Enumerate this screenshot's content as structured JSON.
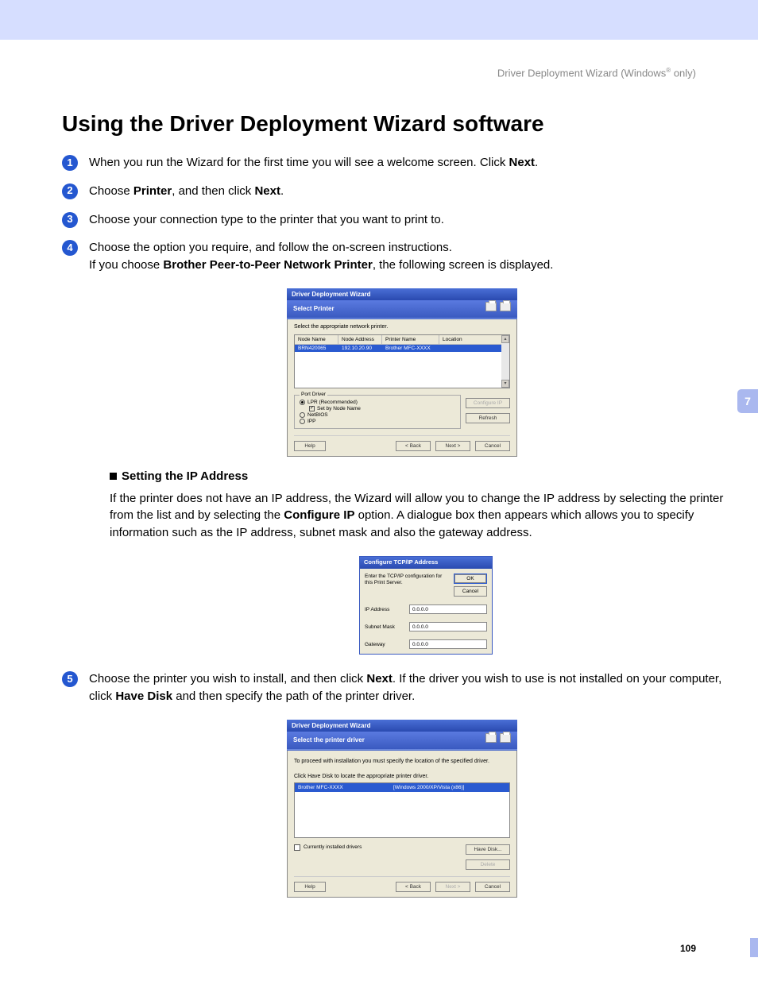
{
  "header": {
    "breadcrumb_pre": "Driver Deployment Wizard (Windows",
    "breadcrumb_post": " only)",
    "reg": "®"
  },
  "title": "Using the Driver Deployment Wizard software",
  "steps": {
    "1": {
      "pre": "When you run the Wizard for the first time you will see a welcome screen. Click ",
      "b1": "Next",
      "post": "."
    },
    "2": {
      "pre": "Choose ",
      "b1": "Printer",
      "mid": ", and then click ",
      "b2": "Next",
      "post": "."
    },
    "3": {
      "text": "Choose your connection type to the printer that you want to print to."
    },
    "4": {
      "line1": "Choose the option you require, and follow the on-screen instructions.",
      "line2_pre": "If you choose ",
      "line2_b": "Brother Peer-to-Peer Network Printer",
      "line2_post": ", the following screen is displayed."
    },
    "5": {
      "pre": "Choose the printer you wish to install, and then click ",
      "b1": "Next",
      "mid": ". If the driver you wish to use is not installed on your computer, click ",
      "b2": "Have Disk",
      "post": " and then specify the path of the printer driver."
    }
  },
  "sub": {
    "heading": "Setting the IP Address",
    "body_pre": "If the printer does not have an IP address, the Wizard will allow you to change the IP address by selecting the printer from the list and by selecting the ",
    "body_b": "Configure IP",
    "body_post": " option. A dialogue box then appears which allows you to specify information such as the IP address, subnet mask and also the gateway address."
  },
  "dlg1": {
    "title": "Driver Deployment Wizard",
    "subtitle": "Select Printer",
    "instruction": "Select the appropriate network printer.",
    "cols": {
      "c1": "Node Name",
      "c2": "Node Address",
      "c3": "Printer Name",
      "c4": "Location"
    },
    "row": {
      "c1": "BRN420065",
      "c2": "192.10.20.90",
      "c3": "Brother  MFC-XXXX",
      "c4": ""
    },
    "fieldset_legend": "Port Driver",
    "opt_lpr": "LPR (Recommended)",
    "opt_setbynode": "Set by Node Name",
    "opt_netbios": "NetBIOS",
    "opt_ipp": "IPP",
    "btn_configip": "Configure IP",
    "btn_refresh": "Refresh",
    "btn_help": "Help",
    "btn_back": "< Back",
    "btn_next": "Next >",
    "btn_cancel": "Cancel"
  },
  "dlg2": {
    "title": "Configure TCP/IP Address",
    "instruction": "Enter the TCP/IP configuration for this Print Server.",
    "btn_ok": "OK",
    "btn_cancel": "Cancel",
    "lbl_ip": "IP Address",
    "lbl_mask": "Subnet Mask",
    "lbl_gw": "Gateway",
    "val_ip": "0.0.0.0",
    "val_mask": "0.0.0.0",
    "val_gw": "0.0.0.0"
  },
  "dlg3": {
    "title": "Driver Deployment Wizard",
    "subtitle": "Select the printer driver",
    "instr1": "To proceed with installation you must specify the location of the specified driver.",
    "instr2": "Click Have Disk to locate the appropriate printer driver.",
    "row": {
      "c1": "Brother  MFC-XXXX",
      "c2": "[Windows 2000/XP/Vista (x86)]"
    },
    "chk_label": "Currently installed drivers",
    "btn_havedisk": "Have Disk...",
    "btn_delete": "Delete",
    "btn_help": "Help",
    "btn_back": "< Back",
    "btn_next": "Next >",
    "btn_cancel": "Cancel"
  },
  "page": {
    "chapter": "7",
    "number": "109"
  }
}
